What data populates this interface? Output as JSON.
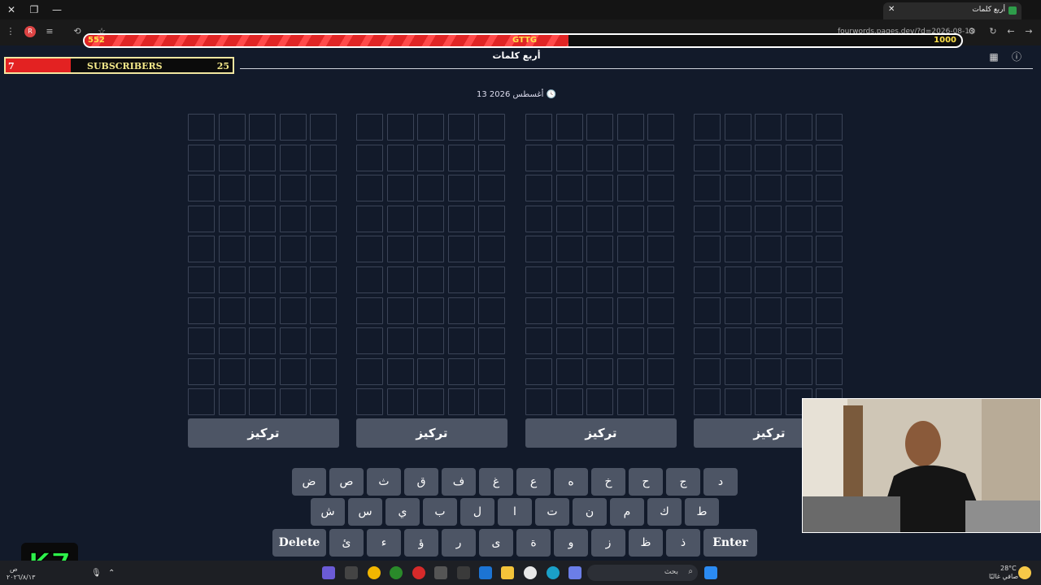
{
  "browser": {
    "tab_title": "أربع كلمات",
    "url": "fourwords.pages.dev/?d=2026-08-13"
  },
  "overlay": {
    "progress_current": "552",
    "progress_label": "GTTG",
    "progress_goal": "1000",
    "progress_fraction": 0.552,
    "subs_count": "7",
    "subs_label": "SUBSCRIBERS",
    "subs_goal": "25"
  },
  "app": {
    "title": "أربع كلمات",
    "date": "13 أغسطس 2026",
    "boards": [
      {
        "focus_label": "تركيز"
      },
      {
        "focus_label": "تركيز"
      },
      {
        "focus_label": "تركيز"
      },
      {
        "focus_label": "تركيز"
      }
    ]
  },
  "keyboard": {
    "row1": [
      "د",
      "ج",
      "ح",
      "خ",
      "ه",
      "ع",
      "غ",
      "ف",
      "ق",
      "ث",
      "ص",
      "ض"
    ],
    "row2": [
      "ط",
      "ك",
      "م",
      "ن",
      "ت",
      "ا",
      "ل",
      "ب",
      "ي",
      "س",
      "ش"
    ],
    "row3": [
      "Enter",
      "ذ",
      "ظ",
      "ز",
      "و",
      "ة",
      "ى",
      "ر",
      "ؤ",
      "ء",
      "ئ",
      "Delete"
    ]
  },
  "taskbar": {
    "search_placeholder": "بحث",
    "weather_temp": "28°C",
    "weather_desc": "صافي غالبًا",
    "clock_time": "ص",
    "clock_date": "٢٠٢٦/٨/١٣"
  },
  "colors": {
    "background": "#121a2a",
    "key": "#4d5565",
    "cell_border": "#3b4457",
    "progress_red": "#e02525",
    "progress_text": "#ffe14a"
  }
}
